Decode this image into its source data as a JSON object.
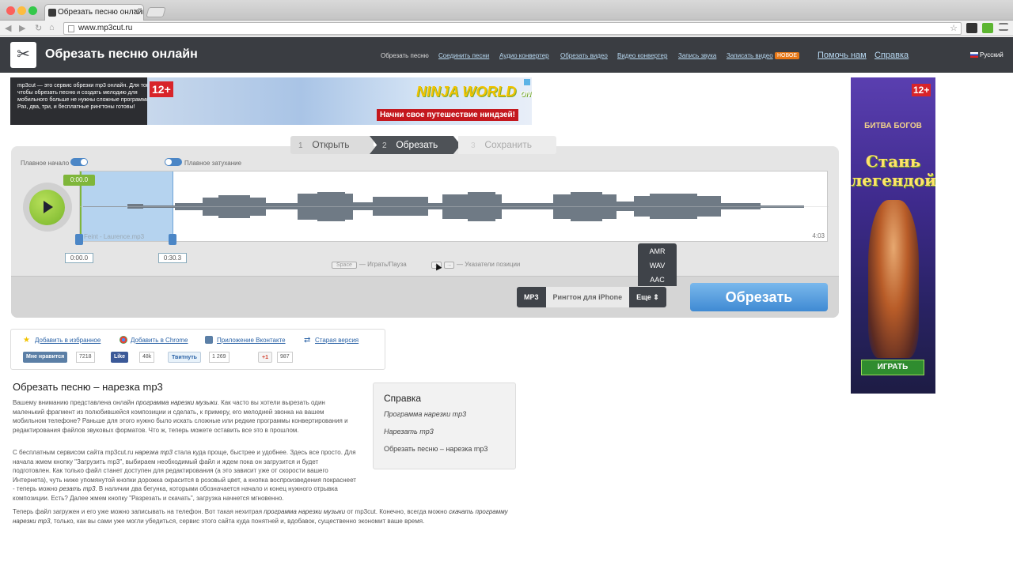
{
  "browser": {
    "tab_title": "Обрезать песню онлайн",
    "url": "www.mp3cut.ru",
    "tab_close": "✕",
    "nav_back": "◀",
    "nav_forward": "▶",
    "nav_reload": "↻",
    "nav_home": "⌂",
    "bookmark_star": "☆"
  },
  "site": {
    "logo_glyph": "✂",
    "title": "Обрезать песню онлайн",
    "nav": {
      "current": "Обрезать песню",
      "join": "Соединить песни",
      "audio_converter": "Аудио конвертер",
      "cut_video": "Обрезать видео",
      "video_converter": "Видео конвертер",
      "record_audio": "Запись звука",
      "record_video": "Записать видео",
      "new_badge": "НОВОЕ",
      "help_us": "Помочь нам",
      "help": "Справка"
    },
    "language": "Русский"
  },
  "ad_banner": {
    "text": "mp3cut — это сервис обрезки mp3 онлайн. Для того чтобы обрезать песню и создать мелодию для мобильного больше не нужны сложные программы. Раз, два, три, и бесплатные рингтоны готовы!",
    "age": "12+",
    "game_title": "NINJA WORLD",
    "game_subtitle": "ONLINE",
    "cta": "Начни свое путешествие ниндзей!"
  },
  "ad_side": {
    "age": "12+",
    "game": "БИТВА БОГОВ",
    "slogan": "Стань легендой!",
    "cta": "ИГРАТЬ"
  },
  "steps": [
    {
      "num": "1",
      "label": "Открыть"
    },
    {
      "num": "2",
      "label": "Обрезать"
    },
    {
      "num": "3",
      "label": "Сохранить"
    }
  ],
  "editor": {
    "fade_in_label": "Плавное начало",
    "fade_out_label": "Плавное затухание",
    "current_time": "0:00.0",
    "track_name": "Feint - Laurence.mp3",
    "duration": "4:03",
    "start_time": "0:00.0",
    "end_time": "0:30.3",
    "hint_space_key": "Space",
    "hint_space": "— Играть/Пауза",
    "hint_arrow_left": "←",
    "hint_arrow_right": "→",
    "hint_arrows": "— Указатели позиции",
    "formats": {
      "mp3": "MP3",
      "iphone": "Рингтон для iPhone",
      "more": "Еще ⇕",
      "options": [
        "AMR",
        "WAV",
        "AAC"
      ]
    },
    "cut_button": "Обрезать",
    "colors": {
      "accent": "#7fb63a",
      "selection": "#b5d3ef",
      "button": "#3f8ad3"
    }
  },
  "social": {
    "favorites": "Добавить в избранное",
    "chrome": "Добавить в Chrome",
    "vk_app": "Приложение Вконтакте",
    "old_version": "Старая версия",
    "vk_like": "Мне нравится",
    "vk_count": "7218",
    "fb_like": "Like",
    "fb_count": "48k",
    "tweet": "Твитнуть",
    "tweet_count": "1 269",
    "gplus": "+1",
    "gplus_count": "987"
  },
  "article": {
    "title": "Обрезать песню – нарезка mp3",
    "p1_a": "Вашему вниманию представлена онлайн ",
    "p1_em": "программа нарезки музыки",
    "p1_b": ". Как часто вы хотели вырезать один маленький фрагмент из полюбившейся композиции и сделать, к примеру, его мелодией звонка на вашем мобильном телефоне? Раньше для этого нужно было искать сложные или редкие программы конвертирования и редактирования файлов звуковых форматов. Что ж, теперь можете оставить все это в прошлом.",
    "p2_a": "С бесплатным сервисом сайта mp3cut.ru ",
    "p2_em": "нарезка mp3",
    "p2_b": " стала куда проще, быстрее и удобнее. Здесь все просто. Для начала жмем кнопку \"Загрузить mp3\", выбираем необходимый файл и ждем пока он загрузится и будет подготовлен. Как только файл станет доступен для редактирования (а это зависит уже от скорости вашего Интернета), чуть ниже упомянутой кнопки дорожка окрасится в розовый цвет, а кнопка воспроизведения покраснеет - теперь можно ",
    "p2_em2": "резать mp3",
    "p2_c": ". В наличии два бегунка, которыми обозначается начало и конец нужного отрывка композиции. Есть? Далее жмем кнопку \"Разрезать и скачать\", загрузка начнется мгновенно.",
    "p3_a": "Теперь файл загружен и его уже можно записывать на телефон. Вот такая нехитрая ",
    "p3_em": "программа нарезки музыки",
    "p3_b": " от mp3cut. Конечно, всегда можно ",
    "p3_em2": "скачать программу нарезки mp3",
    "p3_c": ", только, как вы сами уже могли убедиться, сервис этого сайта куда понятней и, вдобавок, существенно экономит ваше время."
  },
  "help_box": {
    "title": "Справка",
    "link1": "Программа нарезки mp3",
    "link2": "Нарезать mp3",
    "link3": "Обрезать песню – нарезка mp3"
  }
}
